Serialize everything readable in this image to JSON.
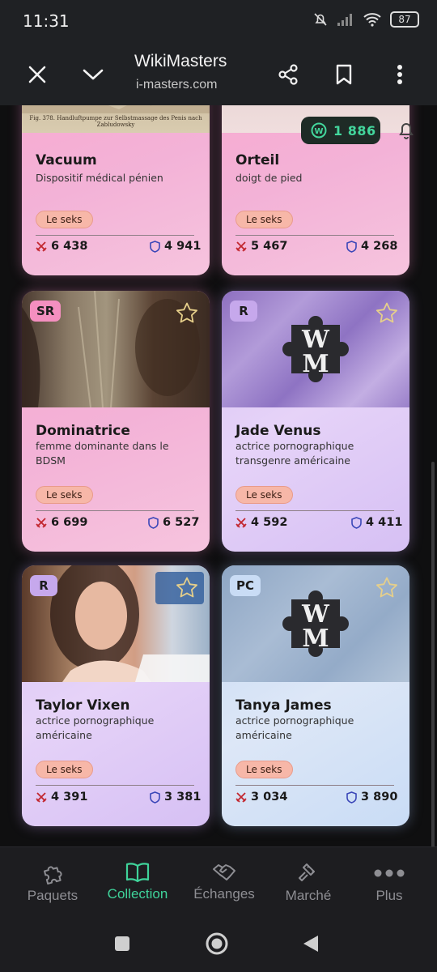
{
  "status_bar": {
    "time": "11:31",
    "battery": "87"
  },
  "browser": {
    "title": "WikiMasters",
    "url": "i-masters.com"
  },
  "wallet": {
    "amount": "1 886",
    "badge_letter": "W"
  },
  "cards": [
    {
      "name": "Vacuum",
      "desc": "Dispositif médical pénien",
      "tag": "Le seks",
      "attack": "6 438",
      "defense": "4 941",
      "image_caption": "Fig. 378. Handluftpumpe zur Selbstmassage des Penis nach Zabludowsky"
    },
    {
      "name": "Orteil",
      "desc": "doigt de pied",
      "tag": "Le seks",
      "attack": "5 467",
      "defense": "4 268"
    },
    {
      "name": "Dominatrice",
      "desc": "femme dominante dans le BDSM",
      "tag": "Le seks",
      "attack": "6 699",
      "defense": "6 527",
      "rarity": "SR"
    },
    {
      "name": "Jade Venus",
      "desc": "actrice pornographique transgenre américaine",
      "tag": "Le seks",
      "attack": "4 592",
      "defense": "4 411",
      "rarity": "R"
    },
    {
      "name": "Taylor Vixen",
      "desc": "actrice pornographique américaine",
      "tag": "Le seks",
      "attack": "4 391",
      "defense": "3 381",
      "rarity": "R"
    },
    {
      "name": "Tanya James",
      "desc": "actrice pornographique américaine",
      "tag": "Le seks",
      "attack": "3 034",
      "defense": "3 890",
      "rarity": "PC"
    }
  ],
  "bottom_nav": [
    {
      "label": "Paquets",
      "icon": "puzzle-icon"
    },
    {
      "label": "Collection",
      "icon": "book-icon",
      "active": true
    },
    {
      "label": "Échanges",
      "icon": "handshake-icon"
    },
    {
      "label": "Marché",
      "icon": "gavel-icon"
    },
    {
      "label": "Plus",
      "icon": "more-dots-icon"
    }
  ],
  "colors": {
    "accent": "#3fd39a",
    "card_pink": "#f6b3d6",
    "card_violet": "#dcc8f5",
    "card_blue": "#cddff5",
    "tag_bg": "#f7b7a8"
  }
}
